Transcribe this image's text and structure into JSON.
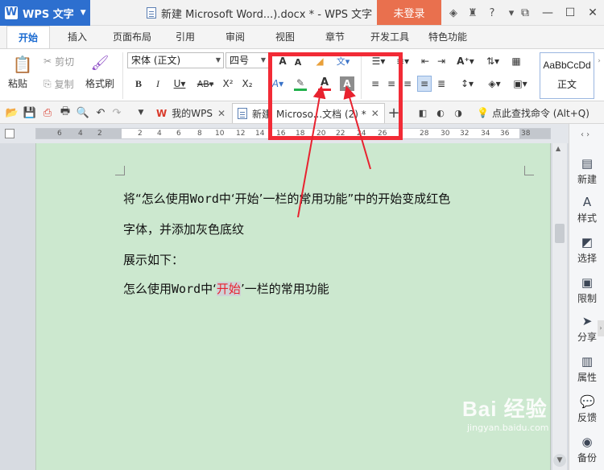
{
  "titlebar": {
    "app_name": "WPS 文字",
    "doc_title": "新建 Microsoft Word...).docx * - WPS 文字",
    "login_label": "未登录"
  },
  "tabs": [
    "开始",
    "插入",
    "页面布局",
    "引用",
    "审阅",
    "视图",
    "章节",
    "开发工具",
    "特色功能"
  ],
  "ribbon": {
    "paste_label": "粘贴",
    "cut_label": "剪切",
    "copy_label": "复制",
    "format_painter_label": "格式刷",
    "font_name": "宋体 (正文)",
    "font_size": "四号",
    "style_sample": "AaBbCcDd",
    "style_name": "正文"
  },
  "doc_tabs": {
    "my_wps": "我的WPS",
    "current_doc_prefix": "新建",
    "current_doc": "Microso...文档 (2) *",
    "search_cmd": "点此查找命令 (Alt+Q)"
  },
  "ruler_labels": [
    "6",
    "4",
    "2",
    "2",
    "4",
    "6",
    "8",
    "10",
    "12",
    "14",
    "16",
    "18",
    "20",
    "22",
    "24",
    "26",
    "28",
    "30",
    "32",
    "34",
    "36",
    "38"
  ],
  "document": {
    "line1_a": "将“怎么使用",
    "line1_b": "Word",
    "line1_c": "中‘开始’一栏的常用功能”中的开始变成红色",
    "line2": "字体，并添加灰色底纹",
    "line3": "展示如下：",
    "line4_a": "怎么使用",
    "line4_b": "Word",
    "line4_c": "中‘",
    "line4_hl": "开始",
    "line4_d": "’一栏的常用功能"
  },
  "side_panel": {
    "items": [
      "新建",
      "样式",
      "选择",
      "限制",
      "分享",
      "属性",
      "反馈",
      "备份"
    ]
  },
  "watermark": {
    "main": "Bai  经验",
    "sub": "jingyan.baidu.com"
  },
  "colors": {
    "app_blue": "#2d6fcf",
    "login_orange": "#e9704e",
    "page_green": "#cce8cf",
    "annotation_red": "#f22b36",
    "highlight_text_red": "#e8222f",
    "shading_gray": "#cfd3d7"
  }
}
